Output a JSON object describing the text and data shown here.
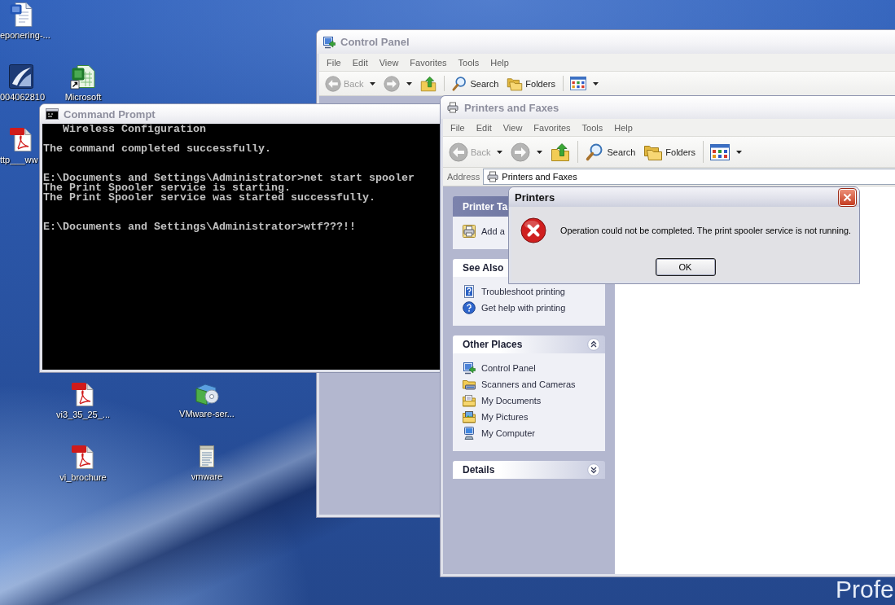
{
  "desktop": {
    "icons": [
      {
        "kind": "word",
        "label": "eponering-...",
        "shortcut": false
      },
      {
        "kind": "app",
        "label": "004062810",
        "shortcut": false
      },
      {
        "kind": "excel",
        "label": "Microsoft",
        "shortcut": true
      },
      {
        "kind": "pdf",
        "label": "ttp___ww",
        "shortcut": false
      },
      {
        "kind": "pdf",
        "label": "vi3_35_25_...",
        "shortcut": false
      },
      {
        "kind": "installer",
        "label": "VMware-ser...",
        "shortcut": false
      },
      {
        "kind": "pdf",
        "label": "vi_brochure",
        "shortcut": false
      },
      {
        "kind": "notepad",
        "label": "vmware",
        "shortcut": false
      }
    ],
    "wallpaper_text": "Profe"
  },
  "control_panel_window": {
    "title": "Control Panel",
    "active": false,
    "menu": [
      "File",
      "Edit",
      "View",
      "Favorites",
      "Tools",
      "Help"
    ],
    "toolbar": [
      [
        {
          "kind": "back",
          "label": "Back",
          "disabled": true,
          "dropdown": true
        },
        {
          "kind": "forward",
          "disabled": true,
          "dropdown": true
        },
        {
          "kind": "up",
          "disabled": false,
          "dropdown": false
        }
      ],
      [
        {
          "kind": "search",
          "label": "Search",
          "disabled": false,
          "dropdown": false
        },
        {
          "kind": "folders",
          "label": "Folders",
          "disabled": false,
          "dropdown": false
        }
      ],
      [
        {
          "kind": "views",
          "disabled": false,
          "dropdown": true
        }
      ]
    ]
  },
  "command_prompt": {
    "title": "Command Prompt",
    "active": false,
    "console_text": "   Wireless Configuration\n\nThe command completed successfully.\n\n\nE:\\Documents and Settings\\Administrator>net start spooler\nThe Print Spooler service is starting.\nThe Print Spooler service was started successfully.\n\n\nE:\\Documents and Settings\\Administrator>wtf???!!"
  },
  "printers_window": {
    "title": "Printers and Faxes",
    "active": false,
    "menu": [
      "File",
      "Edit",
      "View",
      "Favorites",
      "Tools",
      "Help"
    ],
    "toolbar": [
      [
        {
          "kind": "back",
          "label": "Back",
          "disabled": true,
          "dropdown": true
        },
        {
          "kind": "forward",
          "disabled": true,
          "dropdown": true
        },
        {
          "kind": "up",
          "disabled": false,
          "dropdown": false
        }
      ],
      [
        {
          "kind": "search",
          "label": "Search",
          "disabled": false,
          "dropdown": false
        },
        {
          "kind": "folders",
          "label": "Folders",
          "disabled": false,
          "dropdown": false
        }
      ],
      [
        {
          "kind": "views",
          "disabled": false,
          "dropdown": true
        }
      ]
    ],
    "address": {
      "label": "Address",
      "value": "Printers and Faxes"
    },
    "task_pane": [
      {
        "kind": "tasks",
        "title": "Printer Ta",
        "expanded": true,
        "toggle": false,
        "items": [
          {
            "kind": "add-printer",
            "label": "Add a"
          }
        ]
      },
      {
        "kind": "places",
        "title": "See Also",
        "expanded": true,
        "toggle": false,
        "items": [
          {
            "kind": "troubleshoot",
            "label": "Troubleshoot printing"
          },
          {
            "kind": "help",
            "label": "Get help with printing"
          }
        ]
      },
      {
        "kind": "places",
        "title": "Other Places",
        "expanded": true,
        "toggle": true,
        "items": [
          {
            "kind": "control-panel",
            "label": "Control Panel"
          },
          {
            "kind": "scanner",
            "label": "Scanners and Cameras"
          },
          {
            "kind": "my-documents",
            "label": "My Documents"
          },
          {
            "kind": "my-pictures",
            "label": "My Pictures"
          },
          {
            "kind": "my-computer",
            "label": "My Computer"
          }
        ]
      },
      {
        "kind": "places",
        "title": "Details",
        "expanded": false,
        "toggle": true
      }
    ]
  },
  "dialog": {
    "title": "Printers",
    "active": true,
    "kind": "error",
    "message": "Operation could not be completed. The print spooler service is not running.",
    "buttons": [
      "OK"
    ]
  }
}
